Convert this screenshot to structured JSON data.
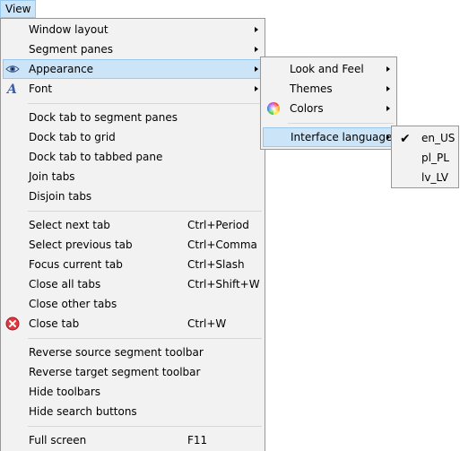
{
  "menubar": {
    "view_label": "View"
  },
  "main_menu": {
    "items": [
      {
        "label": "Window layout"
      },
      {
        "label": "Segment panes"
      },
      {
        "label": "Appearance"
      },
      {
        "label": "Font"
      },
      {
        "label": "Dock tab to segment panes"
      },
      {
        "label": "Dock tab to grid"
      },
      {
        "label": "Dock tab to tabbed pane"
      },
      {
        "label": "Join tabs"
      },
      {
        "label": "Disjoin tabs"
      },
      {
        "label": "Select next tab",
        "shortcut": "Ctrl+Period"
      },
      {
        "label": "Select previous tab",
        "shortcut": "Ctrl+Comma"
      },
      {
        "label": "Focus current tab",
        "shortcut": "Ctrl+Slash"
      },
      {
        "label": "Close all tabs",
        "shortcut": "Ctrl+Shift+W"
      },
      {
        "label": "Close other tabs"
      },
      {
        "label": "Close tab",
        "shortcut": "Ctrl+W"
      },
      {
        "label": "Reverse source segment toolbar"
      },
      {
        "label": "Reverse target segment toolbar"
      },
      {
        "label": "Hide toolbars"
      },
      {
        "label": "Hide search buttons"
      },
      {
        "label": "Full screen",
        "shortcut": "F11"
      }
    ]
  },
  "appearance_menu": {
    "items": [
      {
        "label": "Look and Feel"
      },
      {
        "label": "Themes"
      },
      {
        "label": "Colors"
      },
      {
        "label": "Interface language"
      }
    ]
  },
  "language_menu": {
    "items": [
      {
        "label": "en_US",
        "checked": true
      },
      {
        "label": "pl_PL"
      },
      {
        "label": "lv_LV"
      }
    ]
  },
  "colors": {
    "highlight": "#cce4f7",
    "highlight_border": "#99c9ef",
    "menu_bg": "#f2f2f2"
  }
}
